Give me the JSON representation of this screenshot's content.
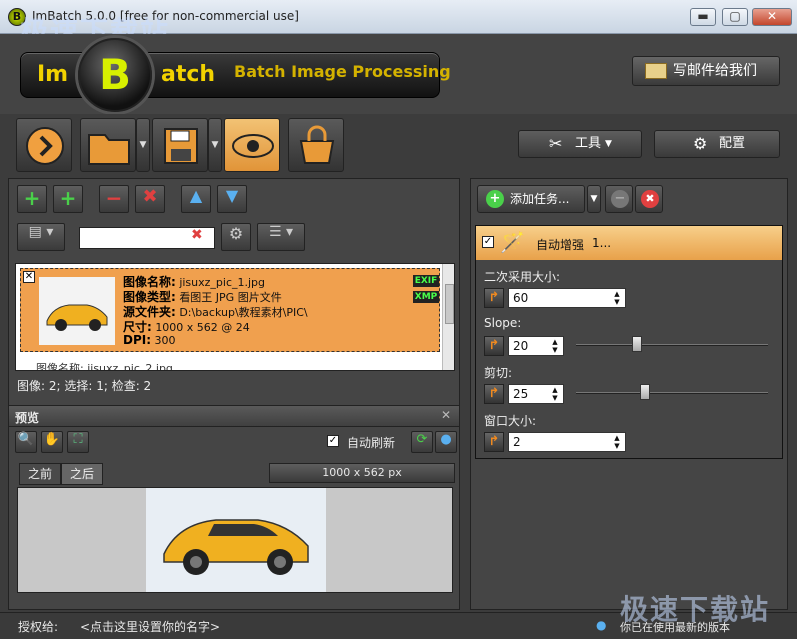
{
  "window": {
    "title": "ImBatch 5.0.0 [free for non-commercial use]",
    "app_icon_letter": "B",
    "minimize_glyph": "▬",
    "maximize_glyph": "▢",
    "close_glyph": "✕"
  },
  "header": {
    "logo_left": "Im",
    "logo_center": "B",
    "logo_right": "atch",
    "logo_subtitle": "Batch Image Processing",
    "mail_button_label": "写邮件给我们"
  },
  "watermarks": {
    "top_left": "极速下载站",
    "bottom_right": "极速下载站"
  },
  "toolbar": {
    "tools_label": "工具",
    "settings_label": "配置"
  },
  "images_panel": {
    "search_value": "",
    "item": {
      "name_label": "图像名称:",
      "name_value": "jisuxz_pic_1.jpg",
      "type_label": "图像类型:",
      "type_value": "看图王 JPG 图片文件",
      "source_label": "源文件夹:",
      "source_value": "D:\\backup\\教程素材\\PIC\\",
      "size_label": "尺寸:",
      "size_value": "1000 x 562 @ 24",
      "dpi_label": "DPI:",
      "dpi_value": "300",
      "tag_exif": "EXIF",
      "tag_xmp": "XMP",
      "next_item_partial": "图像名称: jisuxz_pic_2.jpg"
    },
    "status_text": "图像: 2; 选择: 1; 检查: 2"
  },
  "preview": {
    "title": "预览",
    "auto_refresh_label": "自动刷新",
    "auto_refresh_checked": true,
    "tab_before": "之前",
    "tab_after": "之后",
    "size_text": "1000 x 562 px"
  },
  "tasks_panel": {
    "add_task_label": "添加任务...",
    "task_title": "自动增强",
    "task_suffix": "1...",
    "params": [
      {
        "label": "二次采用大小:",
        "value": "60",
        "has_slider": false
      },
      {
        "label": "Slope:",
        "value": "20",
        "has_slider": true,
        "slider_level": 0.32
      },
      {
        "label": "剪切:",
        "value": "25",
        "has_slider": true,
        "slider_level": 0.36
      },
      {
        "label": "窗口大小:",
        "value": "2",
        "has_slider": false
      }
    ]
  },
  "statusbar": {
    "license_label": "授权给:",
    "license_value": "<点击这里设置你的名字>",
    "version_text": "你已在使用最新的版本"
  },
  "colors": {
    "accent_orange": "#e8a14a",
    "logo_yellow": "#f2d200"
  }
}
